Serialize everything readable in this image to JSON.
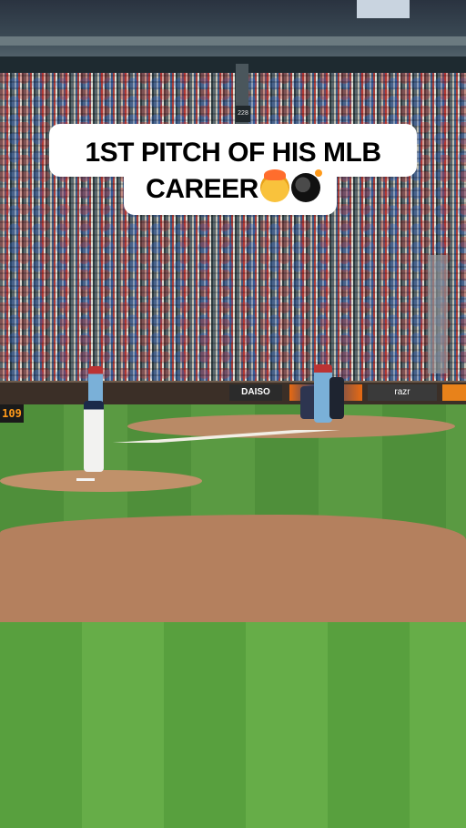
{
  "caption": {
    "line1": "1ST PITCH OF HIS MLB",
    "line2": "CAREER",
    "emojis": [
      "exploding-head",
      "bomb"
    ]
  },
  "stadium": {
    "section_sign": "228",
    "scoreboard_value": "109",
    "ads": [
      "DAISO",
      "razr"
    ]
  },
  "colors": {
    "caption_bg": "#ffffff",
    "caption_text": "#000000",
    "grass": "#5a9a42",
    "dirt": "#b4805e"
  }
}
